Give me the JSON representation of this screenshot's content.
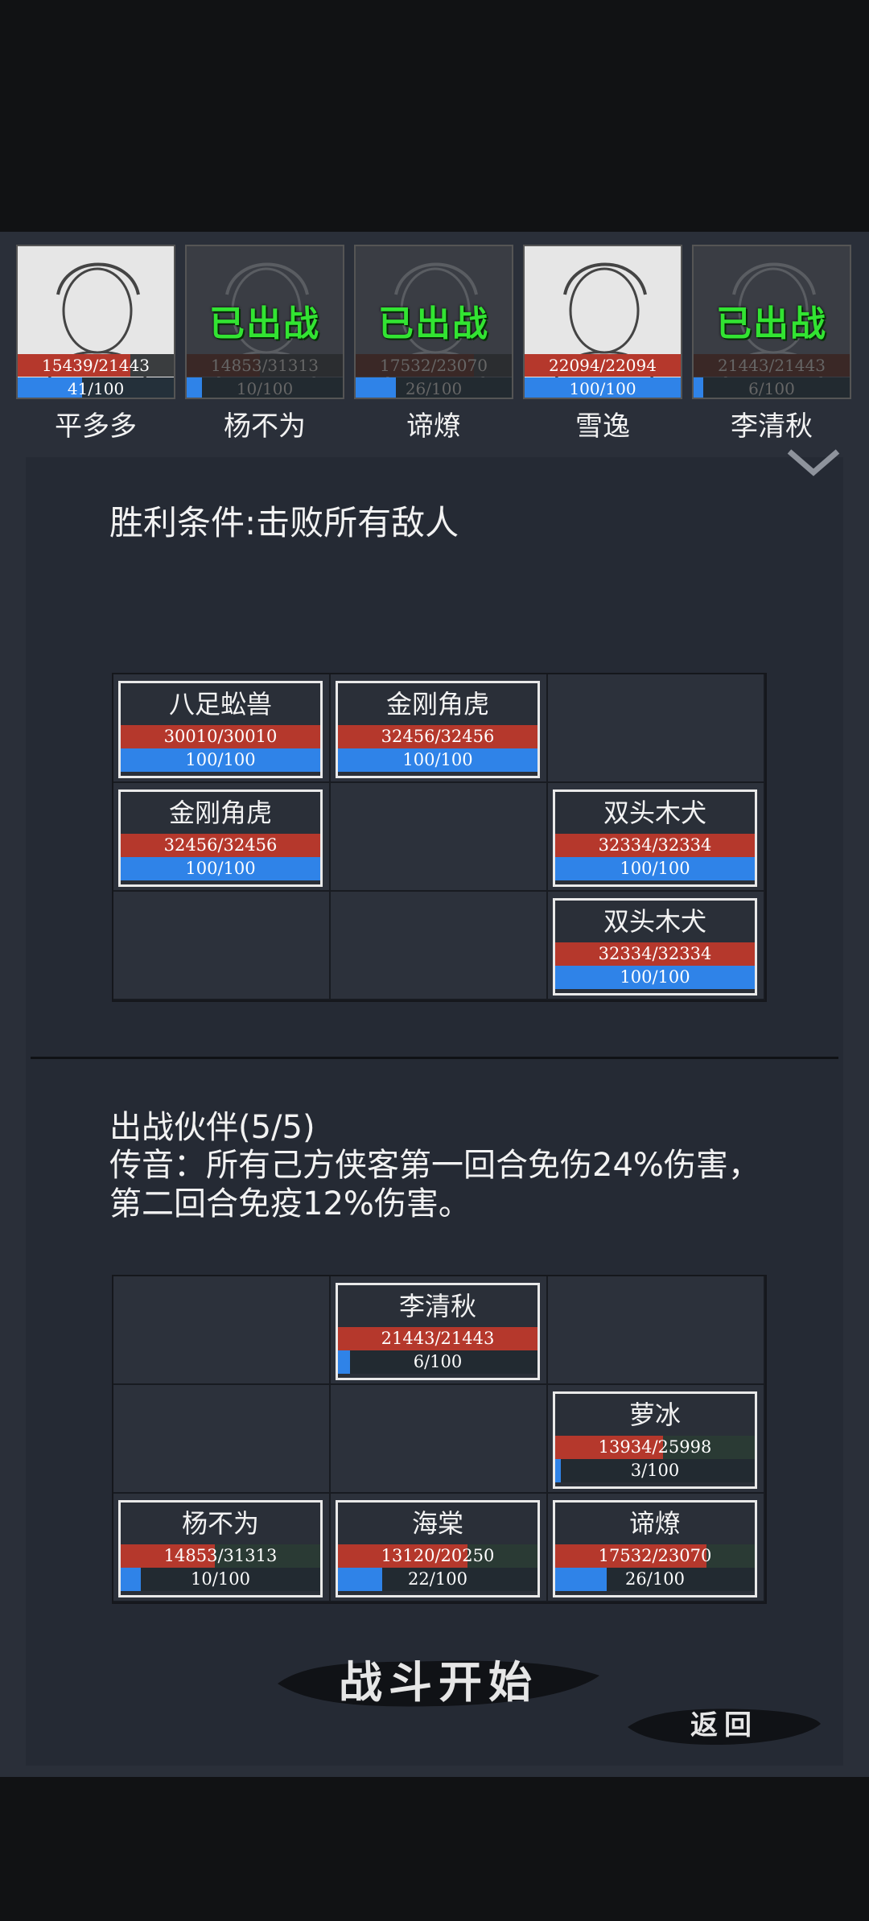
{
  "roster": [
    {
      "name": "平多多",
      "hp": "15439/21443",
      "hp_frac": 0.72,
      "mp": "41/100",
      "mp_frac": 0.41,
      "status": "",
      "active": true
    },
    {
      "name": "杨不为",
      "hp": "14853/31313",
      "hp_frac": 0.47,
      "mp": "10/100",
      "mp_frac": 0.1,
      "status": "已出战",
      "active": false
    },
    {
      "name": "谛燎",
      "hp": "17532/23070",
      "hp_frac": 0.76,
      "mp": "26/100",
      "mp_frac": 0.26,
      "status": "已出战",
      "active": false
    },
    {
      "name": "雪逸",
      "hp": "22094/22094",
      "hp_frac": 1.0,
      "mp": "100/100",
      "mp_frac": 1.0,
      "status": "",
      "active": true
    },
    {
      "name": "李清秋",
      "hp": "21443/21443",
      "hp_frac": 1.0,
      "mp": "6/100",
      "mp_frac": 0.06,
      "status": "已出战",
      "active": false
    }
  ],
  "victory_condition": "胜利条件:击败所有敌人",
  "enemy_grid": [
    {
      "row": 0,
      "col": 0,
      "name": "八足蚣兽",
      "hp": "30010/30010",
      "hp_frac": 1.0,
      "mp": "100/100",
      "mp_frac": 1.0
    },
    {
      "row": 0,
      "col": 1,
      "name": "金刚角虎",
      "hp": "32456/32456",
      "hp_frac": 1.0,
      "mp": "100/100",
      "mp_frac": 1.0
    },
    {
      "row": 1,
      "col": 0,
      "name": "金刚角虎",
      "hp": "32456/32456",
      "hp_frac": 1.0,
      "mp": "100/100",
      "mp_frac": 1.0
    },
    {
      "row": 1,
      "col": 2,
      "name": "双头木犬",
      "hp": "32334/32334",
      "hp_frac": 1.0,
      "mp": "100/100",
      "mp_frac": 1.0
    },
    {
      "row": 2,
      "col": 2,
      "name": "双头木犬",
      "hp": "32334/32334",
      "hp_frac": 1.0,
      "mp": "100/100",
      "mp_frac": 1.0
    }
  ],
  "party_title": "出战伙伴(5/5)",
  "buff_text": "传音：所有己方侠客第一回合免伤24%伤害，第二回合免疫12%伤害。",
  "party_grid": [
    {
      "row": 0,
      "col": 1,
      "name": "李清秋",
      "hp": "21443/21443",
      "hp_frac": 1.0,
      "mp": "6/100",
      "mp_frac": 0.06
    },
    {
      "row": 1,
      "col": 2,
      "name": "萝冰",
      "hp": "13934/25998",
      "hp_frac": 0.54,
      "mp": "3/100",
      "mp_frac": 0.03
    },
    {
      "row": 2,
      "col": 0,
      "name": "杨不为",
      "hp": "14853/31313",
      "hp_frac": 0.47,
      "mp": "10/100",
      "mp_frac": 0.1
    },
    {
      "row": 2,
      "col": 1,
      "name": "海棠",
      "hp": "13120/20250",
      "hp_frac": 0.65,
      "mp": "22/100",
      "mp_frac": 0.22
    },
    {
      "row": 2,
      "col": 2,
      "name": "谛燎",
      "hp": "17532/23070",
      "hp_frac": 0.76,
      "mp": "26/100",
      "mp_frac": 0.26
    }
  ],
  "buttons": {
    "start": "战斗开始",
    "back": "返回"
  },
  "colors": {
    "hp": "#b5382c",
    "mp": "#2f83e8",
    "deployed": "#32e432",
    "panel": "#252a34"
  }
}
